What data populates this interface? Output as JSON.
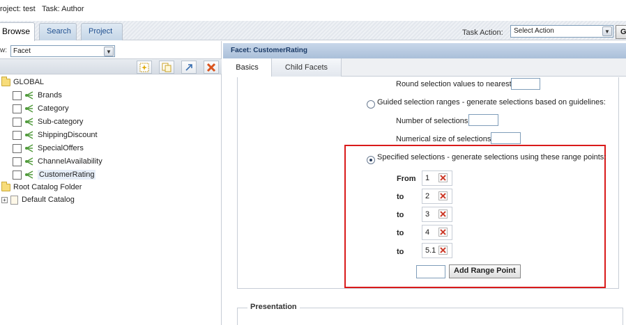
{
  "project_bar": {
    "project": "roject: test",
    "task": "Task: Author"
  },
  "main_tabs": [
    {
      "label": "Browse",
      "active": true
    },
    {
      "label": "Search",
      "active": false
    },
    {
      "label": "Project",
      "active": false
    }
  ],
  "task_action": {
    "label": "Task Action:",
    "selected": "Select Action",
    "go_label": "G"
  },
  "left_pane": {
    "view_label": "w:",
    "view_selected": "Facet",
    "toolbar_icons": [
      "new-facet-icon",
      "copy-icon",
      "link-icon",
      "delete-icon"
    ],
    "tree": {
      "global_label": "GLOBAL",
      "facets": [
        {
          "label": "Brands",
          "selected": false
        },
        {
          "label": "Category",
          "selected": false
        },
        {
          "label": "Sub-category",
          "selected": false
        },
        {
          "label": "ShippingDiscount",
          "selected": false
        },
        {
          "label": "SpecialOffers",
          "selected": false
        },
        {
          "label": "ChannelAvailability",
          "selected": false
        },
        {
          "label": "CustomerRating",
          "selected": true
        }
      ],
      "root_folder_label": "Root Catalog Folder",
      "default_catalog_label": "Default Catalog",
      "expander_symbol": "+"
    }
  },
  "right_pane": {
    "title": "Facet: CustomerRating",
    "subtabs": [
      {
        "label": "Basics",
        "active": true
      },
      {
        "label": "Child Facets",
        "active": false
      }
    ],
    "round_label": "Round selection values to nearest:",
    "guided_label": "Guided selection ranges - generate selections based on guidelines:",
    "num_selections_label": "Number of selections:",
    "num_size_label": "Numerical size of selections:",
    "specified_label": "Specified selections - generate selections using these range points:",
    "range_points": [
      {
        "label": "From",
        "value": "1"
      },
      {
        "label": "to",
        "value": "2"
      },
      {
        "label": "to",
        "value": "3"
      },
      {
        "label": "to",
        "value": "4"
      },
      {
        "label": "to",
        "value": "5.1"
      }
    ],
    "add_range_point_label": "Add Range Point",
    "presentation_label": "Presentation"
  },
  "colors": {
    "highlight_box": "#d91a1a",
    "delete_x": "#cc3b2a",
    "title_bar": "#aabfd9"
  }
}
